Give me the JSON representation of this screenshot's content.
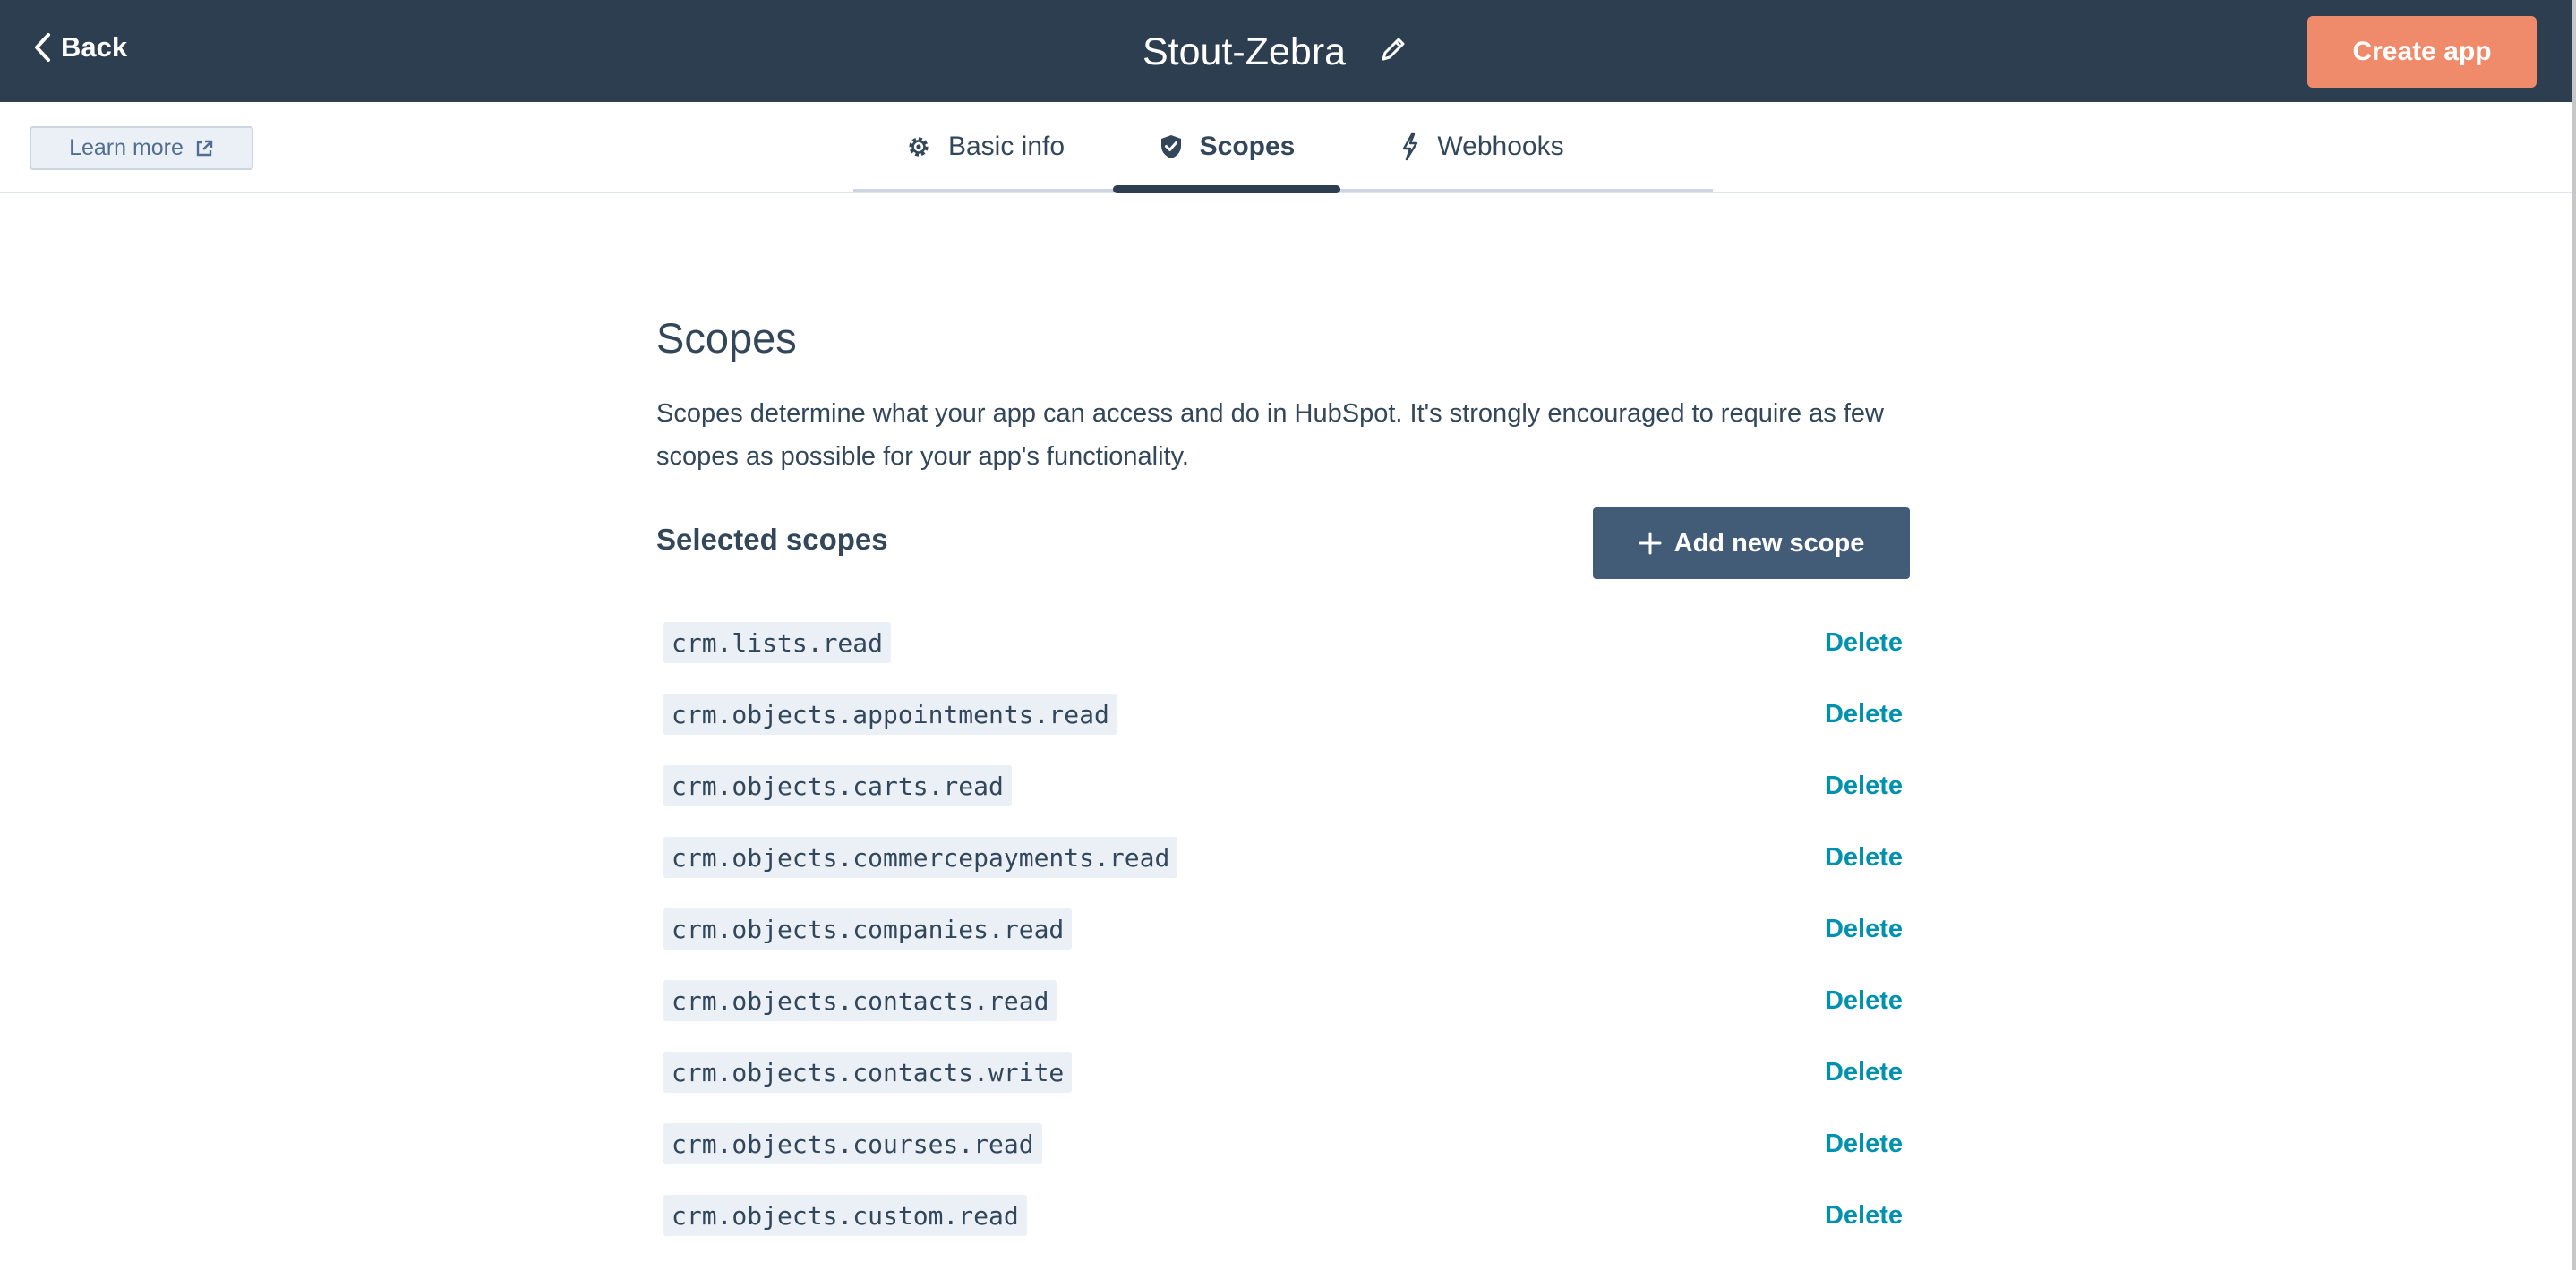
{
  "header": {
    "back_label": "Back",
    "app_name": "Stout-Zebra",
    "create_button_label": "Create app"
  },
  "subbar": {
    "learn_more_label": "Learn more",
    "tabs": [
      {
        "label": "Basic info",
        "icon": "gear-icon",
        "active": false
      },
      {
        "label": "Scopes",
        "icon": "shield-check-icon",
        "active": true
      },
      {
        "label": "Webhooks",
        "icon": "lightning-icon",
        "active": false
      }
    ]
  },
  "main": {
    "title": "Scopes",
    "description": "Scopes determine what your app can access and do in HubSpot. It's strongly encouraged to require as few scopes as possible for your app's functionality.",
    "selected_label": "Selected scopes",
    "add_button_label": "Add new scope",
    "delete_label": "Delete",
    "scopes": [
      "crm.lists.read",
      "crm.objects.appointments.read",
      "crm.objects.carts.read",
      "crm.objects.commercepayments.read",
      "crm.objects.companies.read",
      "crm.objects.contacts.read",
      "crm.objects.contacts.write",
      "crm.objects.courses.read",
      "crm.objects.custom.read"
    ]
  },
  "colors": {
    "topbar_bg": "#2d3e50",
    "create_button": "#ef8a6b",
    "add_button": "#425b76",
    "link": "#0091ae",
    "code_bg": "#eaf0f6",
    "text": "#33475b"
  }
}
